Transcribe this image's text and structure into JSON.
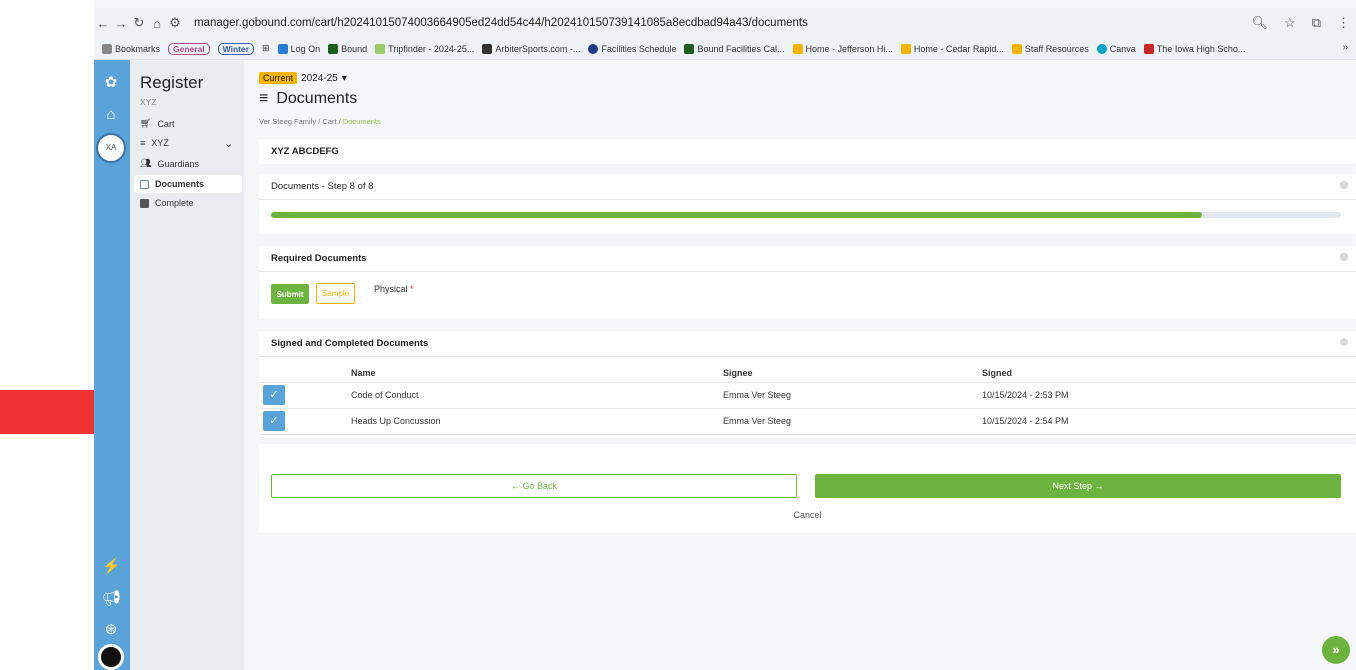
{
  "browser": {
    "url": "manager.gobound.com/cart/h20241015074003664905ed24dd54c44/h20241015073914​1085a8ecdbad94a43/documents",
    "bookmarks": [
      {
        "label": "Bookmarks"
      },
      {
        "label": "General",
        "pill": true
      },
      {
        "label": "Winter",
        "pill": true
      },
      {
        "label": "Log On"
      },
      {
        "label": "Bound"
      },
      {
        "label": "Tripfinder - 2024-25..."
      },
      {
        "label": "ArbiterSports.com -..."
      },
      {
        "label": "Facilities Schedule"
      },
      {
        "label": "Bound Facilities Cal..."
      },
      {
        "label": "Home - Jefferson Hi..."
      },
      {
        "label": "Home - Cedar Rapid..."
      },
      {
        "label": "Staff Resources"
      },
      {
        "label": "Canva"
      },
      {
        "label": "The Iowa High Scho..."
      }
    ],
    "more": "»"
  },
  "rail": {
    "avatar_initials": "XA"
  },
  "sidebar": {
    "title": "Register",
    "subtitle": "XYZ",
    "items": [
      {
        "label": "Cart"
      },
      {
        "label": "XYZ"
      },
      {
        "label": "Guardians"
      },
      {
        "label": "Documents"
      },
      {
        "label": "Complete"
      }
    ]
  },
  "header": {
    "season_badge": "Current",
    "season": "2024-25",
    "title": "Documents",
    "breadcrumb": [
      "Ver Steeg Family",
      "Cart",
      "Documents"
    ]
  },
  "participant": {
    "name": "XYZ ABCDEFG"
  },
  "step": {
    "label": "Documents - Step 8 of 8",
    "progress": 0.87
  },
  "required": {
    "title": "Required Documents",
    "submit_label": "Submit",
    "sample_label": "Sample",
    "document": "Physical",
    "required_mark": "*"
  },
  "signed": {
    "title": "Signed and Completed Documents",
    "columns": [
      "Name",
      "Signee",
      "Signed"
    ],
    "rows": [
      {
        "name": "Code of Conduct",
        "signee": "Emma Ver Steeg",
        "signed": "10/15/2024 - 2:53 PM"
      },
      {
        "name": "Heads Up Concussion",
        "signee": "Emma Ver Steeg",
        "signed": "10/15/2024 - 2:54 PM"
      }
    ]
  },
  "footer": {
    "back_label": "← Go Back",
    "next_label": "Next Step →",
    "cancel_label": "Cancel"
  },
  "colors": {
    "green": "#6db33f",
    "blue": "#5aa3d9",
    "yellow": "#f4b400",
    "arrow": "#f03232"
  }
}
